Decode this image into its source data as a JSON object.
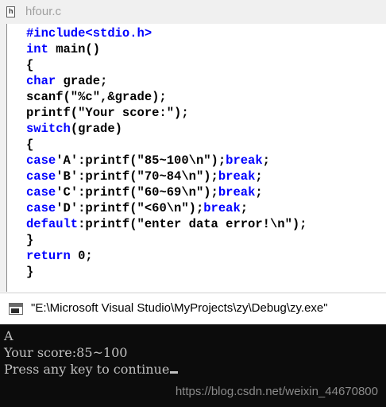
{
  "editor": {
    "tab_title": "hfour.c",
    "code_lines": [
      [
        {
          "t": "#include<stdio.h>",
          "c": "kw"
        }
      ],
      [
        {
          "t": "int",
          "c": "kw"
        },
        {
          "t": " main()",
          "c": ""
        }
      ],
      [
        {
          "t": "{",
          "c": ""
        }
      ],
      [
        {
          "t": "char",
          "c": "kw"
        },
        {
          "t": " grade;",
          "c": ""
        }
      ],
      [
        {
          "t": "scanf(\"%c\",&grade);",
          "c": ""
        }
      ],
      [
        {
          "t": "printf(\"Your score:\");",
          "c": ""
        }
      ],
      [
        {
          "t": "switch",
          "c": "kw"
        },
        {
          "t": "(grade)",
          "c": ""
        }
      ],
      [
        {
          "t": "{",
          "c": ""
        }
      ],
      [
        {
          "t": "case",
          "c": "kw"
        },
        {
          "t": "'A':printf(\"85~100\\n\");",
          "c": ""
        },
        {
          "t": "break",
          "c": "kw"
        },
        {
          "t": ";",
          "c": ""
        }
      ],
      [
        {
          "t": "case",
          "c": "kw"
        },
        {
          "t": "'B':printf(\"70~84\\n\");",
          "c": ""
        },
        {
          "t": "break",
          "c": "kw"
        },
        {
          "t": ";",
          "c": ""
        }
      ],
      [
        {
          "t": "case",
          "c": "kw"
        },
        {
          "t": "'C':printf(\"60~69\\n\");",
          "c": ""
        },
        {
          "t": "break",
          "c": "kw"
        },
        {
          "t": ";",
          "c": ""
        }
      ],
      [
        {
          "t": "case",
          "c": "kw"
        },
        {
          "t": "'D':printf(\"<60\\n\");",
          "c": ""
        },
        {
          "t": "break",
          "c": "kw"
        },
        {
          "t": ";",
          "c": ""
        }
      ],
      [
        {
          "t": "default",
          "c": "kw"
        },
        {
          "t": ":printf(\"enter data error!\\n\");",
          "c": ""
        }
      ],
      [
        {
          "t": "}",
          "c": ""
        }
      ],
      [
        {
          "t": "return",
          "c": "kw"
        },
        {
          "t": " 0;",
          "c": ""
        }
      ],
      [
        {
          "t": "}",
          "c": ""
        }
      ]
    ]
  },
  "console": {
    "title": "\"E:\\Microsoft Visual Studio\\MyProjects\\zy\\Debug\\zy.exe\"",
    "output_lines": [
      "A",
      "Your score:85~100",
      "Press any key to continue"
    ]
  },
  "watermark": "https://blog.csdn.net/weixin_44670800",
  "colors": {
    "keyword": "#0000ff",
    "console_background": "#0c0c0c",
    "console_text": "#c0c0c0"
  },
  "icons": {
    "editor_file": "c-header-file-icon",
    "console_app": "console-window-icon"
  }
}
